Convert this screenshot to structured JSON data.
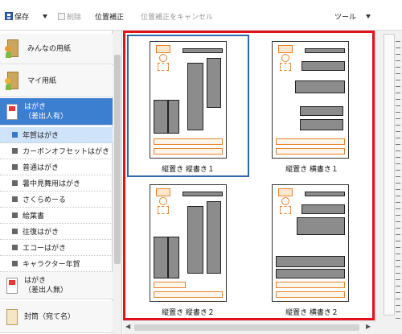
{
  "toolbar": {
    "save_label": "保存",
    "delete_label": "削除",
    "position_fix_label": "位置補正",
    "cancel_fix_label": "位置補正をキャンセル",
    "tools_label": "ツール"
  },
  "sidebar": {
    "categories": [
      {
        "label": "みんなの用紙"
      },
      {
        "label": "マイ用紙"
      },
      {
        "label": "はがき\n（差出人有）"
      },
      {
        "label": "はがき\n（差出人無）"
      },
      {
        "label": "封筒（宛て名）"
      }
    ],
    "items": [
      {
        "label": "年賀はがき"
      },
      {
        "label": "カーボンオフセットはがき"
      },
      {
        "label": "普通はがき"
      },
      {
        "label": "暑中見舞用はがき"
      },
      {
        "label": "さくらめーる"
      },
      {
        "label": "絵葉書"
      },
      {
        "label": "往復はがき"
      },
      {
        "label": "エコーはがき"
      },
      {
        "label": "キャラクター年賀"
      }
    ]
  },
  "templates": [
    {
      "label": "縦置き 縦書き１"
    },
    {
      "label": "縦置き 横書き１"
    },
    {
      "label": "縦置き 縦書き２"
    },
    {
      "label": "縦置き 横書き２"
    }
  ],
  "colors": {
    "accent": "#3c7fd1",
    "highlight_border": "#e4111b",
    "stamp_orange": "#e8822c"
  }
}
